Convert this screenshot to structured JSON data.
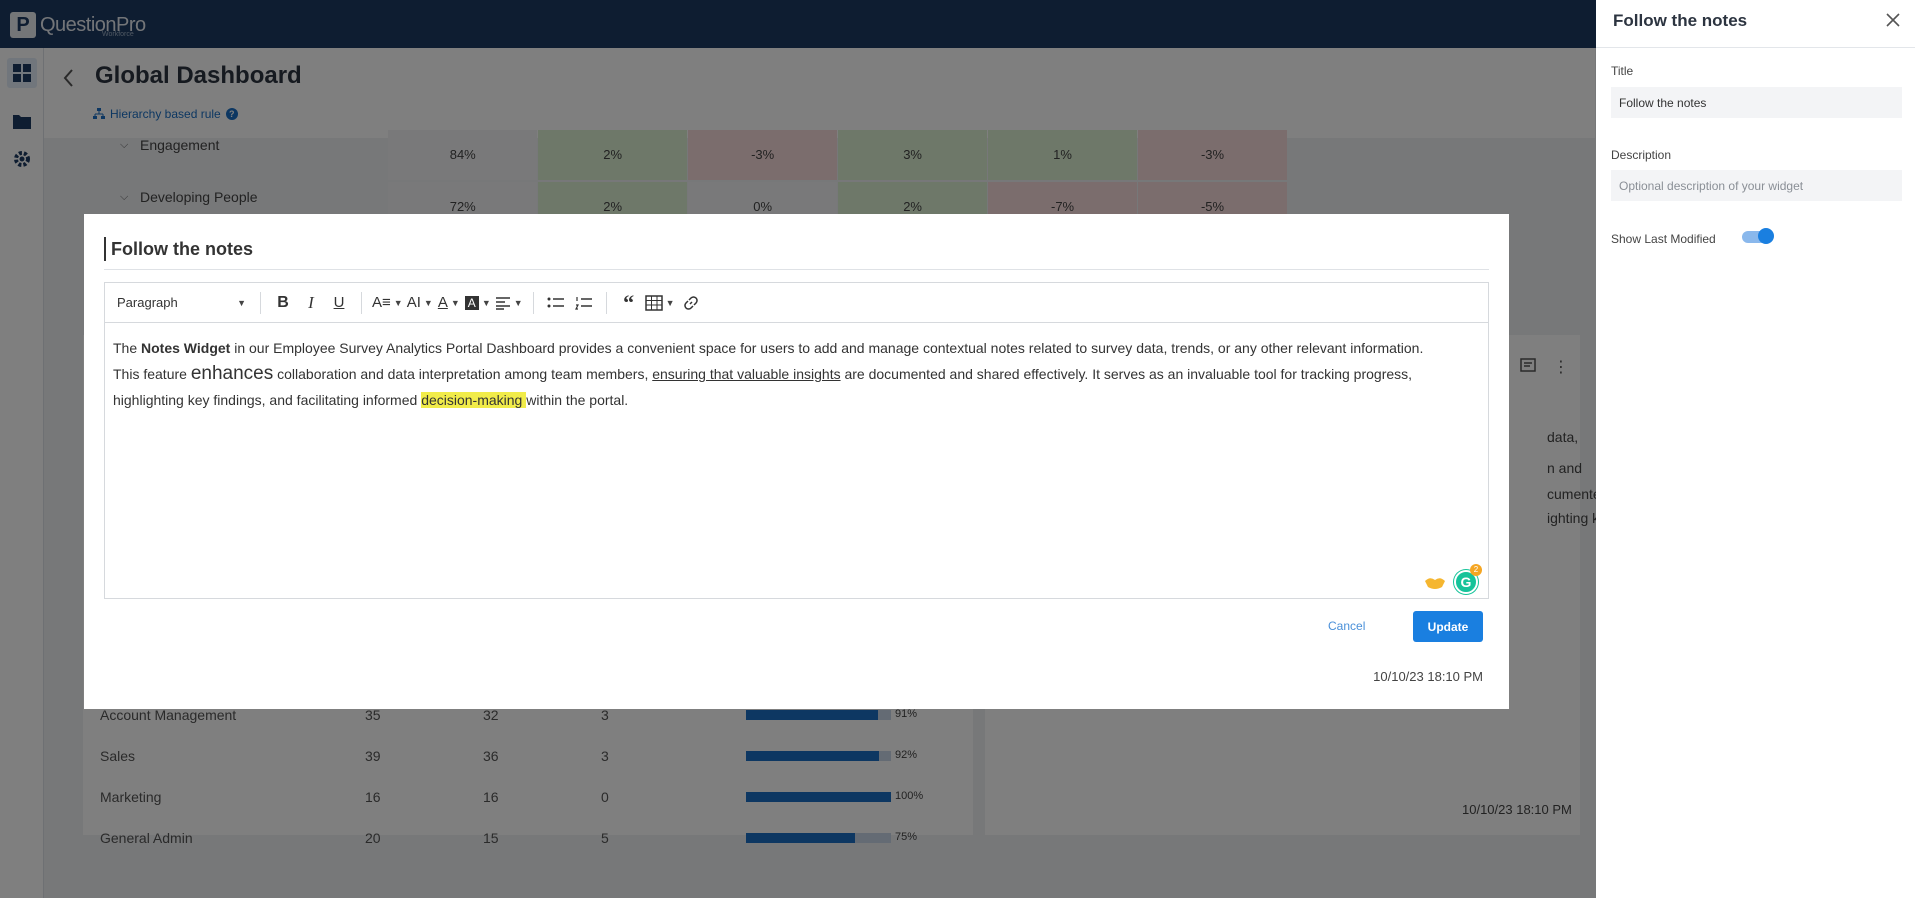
{
  "app": {
    "logo_text": "QuestionPro",
    "logo_letter": "P",
    "logo_sub": "Workforce"
  },
  "page": {
    "title": "Global Dashboard",
    "hierarchy_link": "Hierarchy based rule"
  },
  "background_table": {
    "rows": [
      {
        "label": "Engagement",
        "values": [
          "84%",
          "2%",
          "-3%",
          "3%",
          "1%",
          "-3%"
        ]
      },
      {
        "label": "Developing People",
        "values": [
          "72%",
          "2%",
          "0%",
          "2%",
          "-7%",
          "-5%"
        ]
      }
    ]
  },
  "background_list": {
    "rows": [
      {
        "name": "Account Management",
        "a": "35",
        "b": "32",
        "c": "3",
        "pct": "91%",
        "fill": 0.91
      },
      {
        "name": "Sales",
        "a": "39",
        "b": "36",
        "c": "3",
        "pct": "92%",
        "fill": 0.92
      },
      {
        "name": "Marketing",
        "a": "16",
        "b": "16",
        "c": "0",
        "pct": "100%",
        "fill": 1.0
      },
      {
        "name": "General Admin",
        "a": "20",
        "b": "15",
        "c": "5",
        "pct": "75%",
        "fill": 0.75
      }
    ],
    "side_snippets": [
      "data,",
      "n and",
      "cumented",
      "ighting key"
    ],
    "side_timestamp": "10/10/23 18:10 PM"
  },
  "modal": {
    "title": "Follow the notes",
    "toolbar": {
      "paragraph_select": "Paragraph"
    },
    "content": {
      "p1_a": "The ",
      "p1_bold": "Notes Widget",
      "p1_b": " in our Employee Survey Analytics Portal Dashboard provides a convenient space for users to add and manage contextual notes related to survey data, trends, or any other relevant information.",
      "p2_a": "This feature ",
      "p2_big": "enhances",
      "p2_b": " collaboration and data interpretation among team members, ",
      "p2_underline": "ensuring that valuable insights",
      "p2_c": " are documented and shared effectively. It serves as an invaluable tool for tracking progress, highlighting key findings, and facilitating informed ",
      "p2_highlight": "decision-making ",
      "p2_d": "within the portal."
    },
    "grammarly_count": "2",
    "cancel_label": "Cancel",
    "update_label": "Update",
    "timestamp": "10/10/23 18:10 PM"
  },
  "panel": {
    "title": "Follow the notes",
    "title_label": "Title",
    "title_value": "Follow the notes",
    "description_label": "Description",
    "description_placeholder": "Optional description of your widget",
    "show_last_modified_label": "Show Last Modified",
    "show_last_modified": true
  },
  "colors": {
    "topbar": "#1d3b62",
    "accent": "#1a7fe0",
    "highlight": "#f1ec4a"
  }
}
